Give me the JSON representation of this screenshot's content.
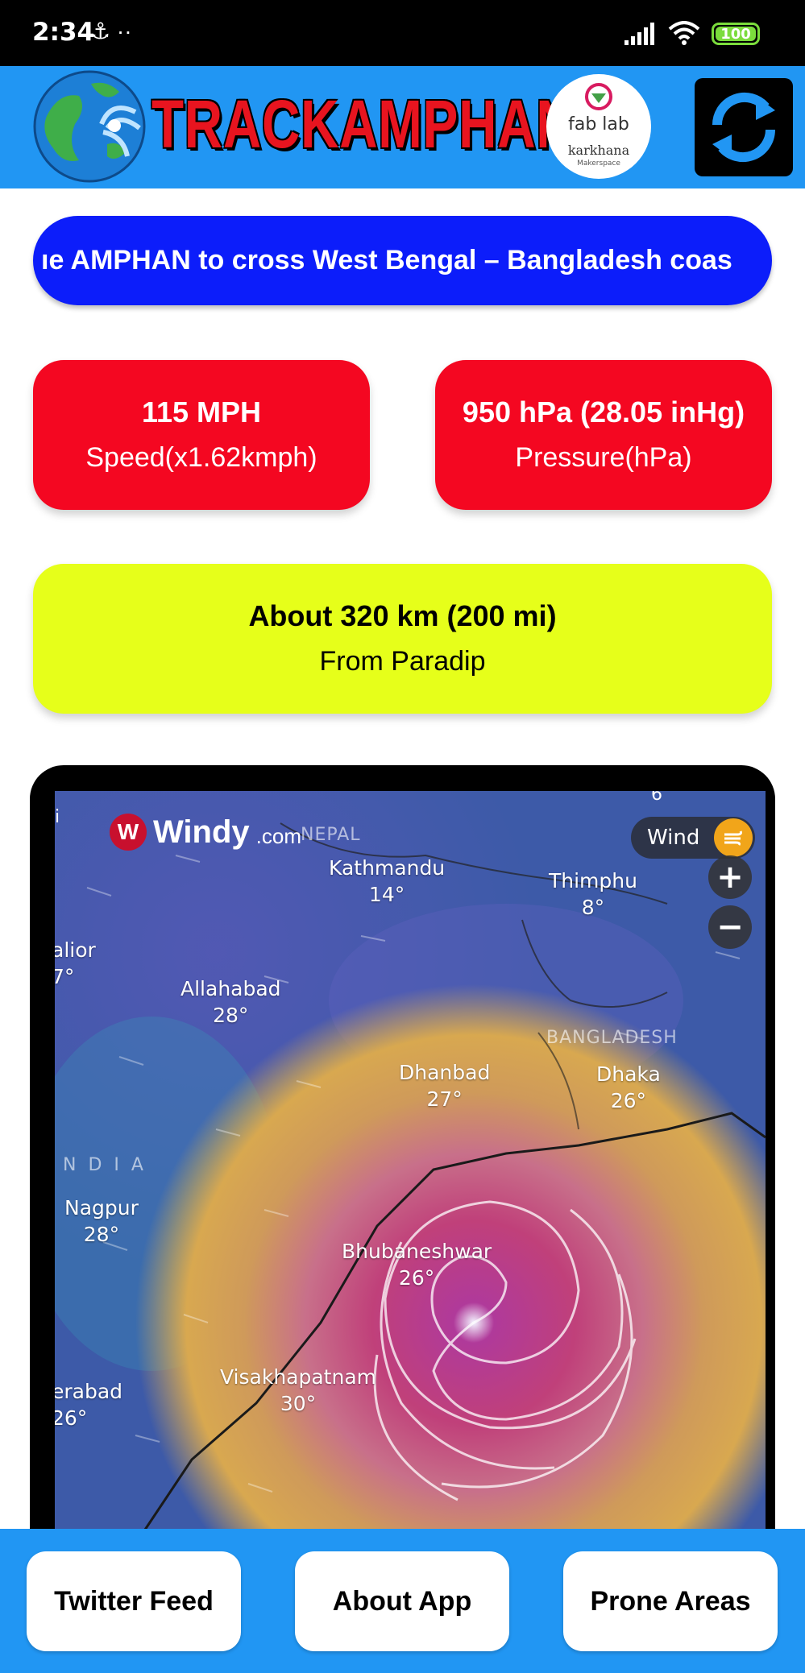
{
  "status_bar": {
    "time": "2:34",
    "left_icons": "⚓ ··",
    "battery": "100",
    "network": "4"
  },
  "header": {
    "title": "TRACKAMPHAN",
    "logo_text_top": "fab lab",
    "logo_text_bottom": "karkhana",
    "logo_subtext": "Makerspace"
  },
  "ticker": {
    "text": "ıe AMPHAN to cross West Bengal – Bangladesh coas"
  },
  "cards": {
    "speed_value": "115 MPH",
    "speed_label": "Speed(x1.62kmph)",
    "pressure_value": "950 hPa (28.05 inHg)",
    "pressure_label": "Pressure(hPa)",
    "distance_value": "About 320 km (200 mi)",
    "distance_label": "From Paradip"
  },
  "map": {
    "brand_name": "Windy",
    "brand_domain": ".com",
    "layer_label": "Wind",
    "zoom_in": "+",
    "zoom_out": "−",
    "regions": {
      "nepal": "NEPAL",
      "bangladesh": "BANGLADESH",
      "india": "N D I A",
      "edge_i": "i",
      "edge_6": "6"
    },
    "cities": [
      {
        "name": "Kathmandu",
        "temp": "14°"
      },
      {
        "name": "Thimphu",
        "temp": "8°"
      },
      {
        "name": "alior",
        "temp": "7°"
      },
      {
        "name": "Allahabad",
        "temp": "28°"
      },
      {
        "name": "Dhanbad",
        "temp": "27°"
      },
      {
        "name": "Dhaka",
        "temp": "26°"
      },
      {
        "name": "Nagpur",
        "temp": "28°"
      },
      {
        "name": "Bhubaneshwar",
        "temp": "26°"
      },
      {
        "name": "Visakhapatnam",
        "temp": "30°"
      },
      {
        "name": "erabad",
        "temp": "26°"
      }
    ]
  },
  "nav": {
    "twitter": "Twitter Feed",
    "about": "About App",
    "prone": "Prone Areas"
  },
  "colors": {
    "header_blue": "#2196f3",
    "ticker_blue": "#0c1dfa",
    "card_red": "#f40721",
    "card_yellow": "#e6ff1a",
    "title_red": "#e8141f"
  }
}
